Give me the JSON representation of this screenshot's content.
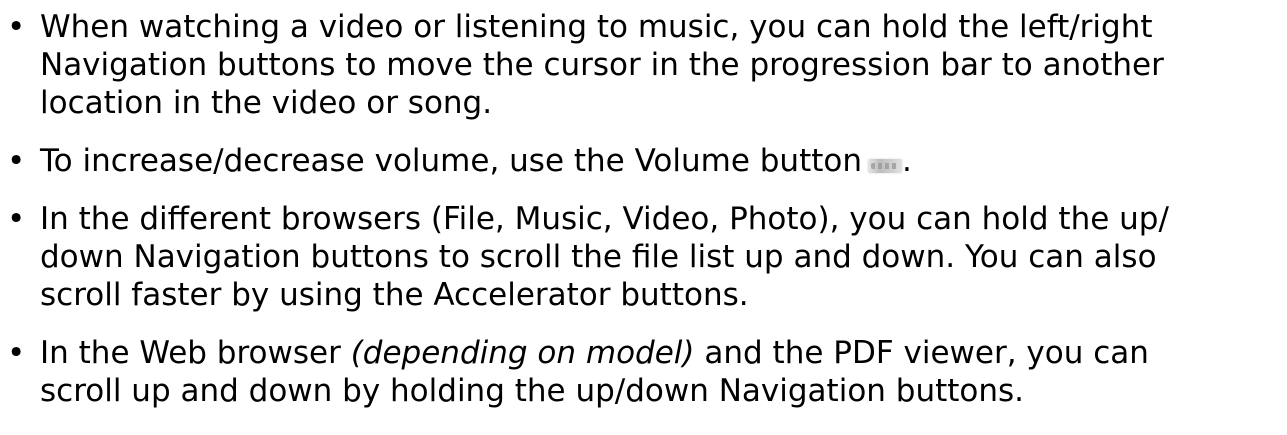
{
  "bullet_glyph": "•",
  "items": [
    {
      "lines": [
        "When watching a video or listening to music, you can hold the left/right",
        "Navigation buttons to move the cursor in the progression bar to another",
        "location in the video or song."
      ]
    },
    {
      "before_icon": "To increase/decrease volume, use the Volume button",
      "icon": "volume-button-icon",
      "after_icon": "."
    },
    {
      "lines": [
        "In the different browsers (File, Music, Video, Photo), you can hold the up/",
        "down Navigation buttons to scroll the file list up and down. You can also",
        "scroll faster by using the Accelerator buttons."
      ]
    },
    {
      "line1_before_italic": "In the Web browser ",
      "line1_italic": "(depending on model)",
      "line1_after_italic": " and the PDF viewer, you can",
      "line2": "scroll up and down by holding the up/down Navigation buttons."
    }
  ]
}
